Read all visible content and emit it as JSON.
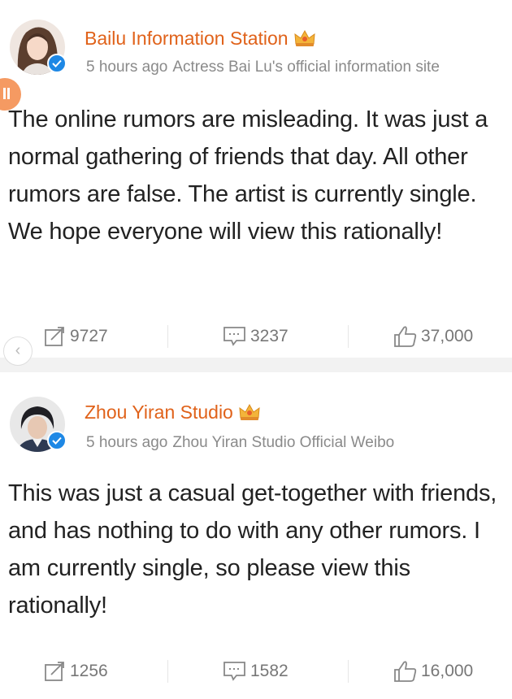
{
  "posts": [
    {
      "author": "Bailu Information Station",
      "time": "5 hours ago",
      "description": "Actress Bai Lu's official information site",
      "text": "The online rumors are misleading. It was just a normal gathering of friends that day. All other rumors are false. The artist is currently single. We hope everyone will view this rationally!",
      "reposts": "9727",
      "comments": "3237",
      "likes": "37,000"
    },
    {
      "author": "Zhou Yiran Studio",
      "time": "5 hours ago",
      "description": "Zhou Yiran Studio Official Weibo",
      "text": "This was just a casual get-together with friends, and has nothing to do with any other rumors. I am currently single, so please view this rationally!",
      "reposts": "1256",
      "comments": "1582",
      "likes": "16,000"
    }
  ],
  "colors": {
    "author_name": "#e0621a",
    "meta_text": "#8a8a8a",
    "verified_badge": "#1e88e5",
    "divider": "#f2f2f2"
  },
  "icons": [
    "verified-badge-icon",
    "crown-icon",
    "repost-icon",
    "comment-icon",
    "like-icon",
    "back-arrow-icon"
  ]
}
